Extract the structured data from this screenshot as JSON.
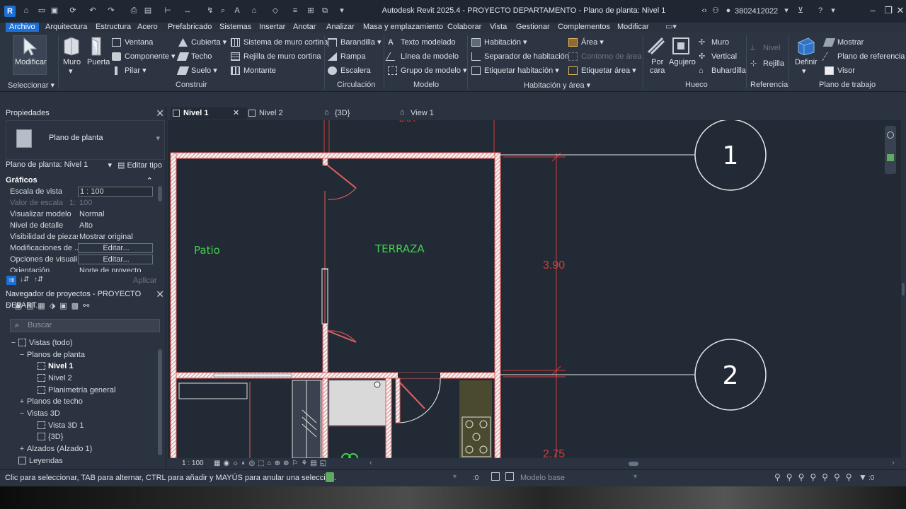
{
  "app": {
    "title": "Autodesk Revit 2025.4 - PROYECTO DEPARTAMENTO - Plano de planta: Nivel 1",
    "user": "3802412022",
    "logo_letter": "R"
  },
  "menu_tabs": [
    "Archivo",
    "Arquitectura",
    "Estructura",
    "Acero",
    "Prefabricado",
    "Sistemas",
    "Insertar",
    "Anotar",
    "Analizar",
    "Masa y emplazamiento",
    "Colaborar",
    "Vista",
    "Gestionar",
    "Complementos",
    "Modificar"
  ],
  "ribbon": {
    "select": {
      "modify": "Modificar",
      "panel": "Seleccionar"
    },
    "construir": {
      "muro": "Muro",
      "puerta": "Puerta",
      "ventana": "Ventana",
      "componente": "Componente",
      "pilar": "Pilar",
      "cubierta": "Cubierta",
      "techo": "Techo",
      "suelo": "Suelo",
      "sistema_muro_cortina": "Sistema de muro cortina",
      "rejilla_muro_cortina": "Rejilla de muro cortina",
      "montante": "Montante",
      "panel": "Construir"
    },
    "circulacion": {
      "barandilla": "Barandilla",
      "rampa": "Rampa",
      "escalera": "Escalera",
      "panel": "Circulación"
    },
    "modelo": {
      "texto": "Texto modelado",
      "linea": "Línea de modelo",
      "grupo": "Grupo de modelo",
      "panel": "Modelo"
    },
    "habitacion": {
      "habitacion": "Habitación",
      "separador": "Separador de habitación",
      "etiquetar_hab": "Etiquetar habitación",
      "area": "Área",
      "contorno": "Contorno de área",
      "etiquetar_area": "Etiquetar área",
      "panel": "Habitación y área"
    },
    "hueco": {
      "por_cara_1": "Por",
      "por_cara_2": "cara",
      "agujero": "Agujero",
      "muro": "Muro",
      "vertical": "Vertical",
      "buhardilla": "Buhardilla",
      "panel": "Hueco"
    },
    "referencia": {
      "nivel": "Nivel",
      "rejilla": "Rejilla",
      "panel": "Referencia"
    },
    "plano_trabajo": {
      "definir": "Definir",
      "mostrar": "Mostrar",
      "plano_ref": "Plano de referencia",
      "visor": "Visor",
      "panel": "Plano de trabajo"
    }
  },
  "properties": {
    "header": "Propiedades",
    "type_name": "Plano de planta",
    "instance": "Plano de planta: Nivel 1",
    "edit_type": "Editar tipo",
    "group": "Gráficos",
    "rows": [
      {
        "k": "Escala de vista",
        "v": "1 : 100"
      },
      {
        "k": "Valor de escala",
        "k2": "1:",
        "v": "100"
      },
      {
        "k": "Visualizar modelo",
        "v": "Normal"
      },
      {
        "k": "Nivel de detalle",
        "v": "Alto"
      },
      {
        "k": "Visibilidad de piezas",
        "v": "Mostrar original"
      },
      {
        "k": "Modificaciones de ...",
        "v": "Editar..."
      },
      {
        "k": "Opciones de visuali...",
        "v": "Editar..."
      },
      {
        "k": "Orientación",
        "v": "Norte de proyecto"
      }
    ],
    "apply": "Aplicar"
  },
  "navigator": {
    "header": "Navegador de proyectos - PROYECTO DEPART...",
    "search_placeholder": "Buscar",
    "items": [
      {
        "label": "Vistas (todo)",
        "sym": "−"
      },
      {
        "label": "Planos de planta",
        "sym": "−"
      },
      {
        "label": "Nivel 1"
      },
      {
        "label": "Nivel 2"
      },
      {
        "label": "Planimetría general"
      },
      {
        "label": "Planos de techo",
        "sym": "+"
      },
      {
        "label": "Vistas 3D",
        "sym": "−"
      },
      {
        "label": "Vista 3D 1"
      },
      {
        "label": "{3D}"
      },
      {
        "label": "Alzados (Alzado 1)",
        "sym": "+"
      },
      {
        "label": "Leyendas"
      }
    ]
  },
  "view_tabs": [
    "Nivel 1",
    "Nivel 2",
    "{3D}",
    "View 1"
  ],
  "drawing": {
    "room_1": "Patio",
    "room_2": "TERRAZA",
    "dim_1": "3.90",
    "dim_2": "2.75",
    "grid_1": "1",
    "grid_2": "2",
    "colors": {
      "wall": "#e06060",
      "text_green": "#3fd24a",
      "dim": "#d23c3c",
      "bg": "#222a35"
    }
  },
  "view_scale": "1 : 100",
  "status": {
    "hint": "Clic para seleccionar, TAB para alternar, CTRL para añadir y MAYÚS para anular una selección.",
    "zero_a": ":0",
    "model": "Modelo base",
    "zero_b": ":0"
  }
}
